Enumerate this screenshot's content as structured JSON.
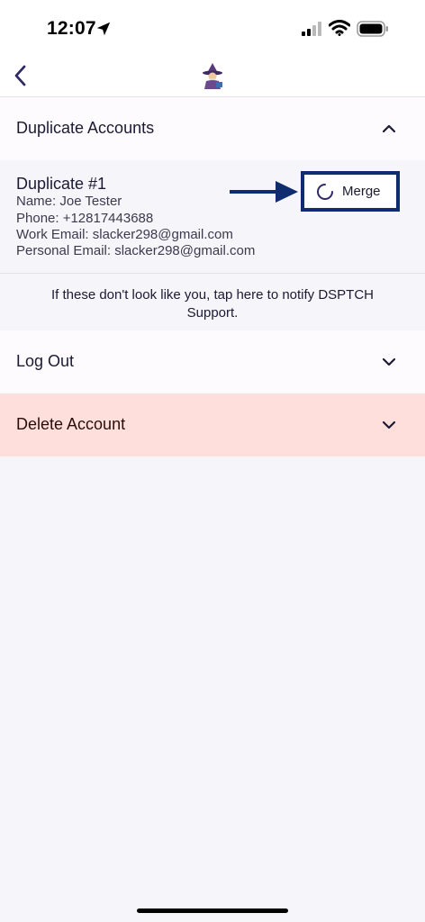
{
  "status_bar": {
    "time": "12:07",
    "icons": [
      "location-arrow-icon",
      "cellular-signal-icon",
      "wifi-icon",
      "battery-icon"
    ]
  },
  "nav": {
    "back_icon": "chevron-left-icon",
    "avatar_icon": "wizard-avatar-icon"
  },
  "sections": {
    "duplicate_accounts": {
      "label": "Duplicate Accounts",
      "expanded": true
    },
    "log_out": {
      "label": "Log Out",
      "expanded": false
    },
    "delete_account": {
      "label": "Delete Account",
      "expanded": false
    }
  },
  "duplicate": {
    "title": "Duplicate #1",
    "name": "Name: Joe Tester",
    "phone": "Phone: +12817443688",
    "work_email": "Work Email: slacker298@gmail.com",
    "personal_email": "Personal Email: slacker298@gmail.com",
    "merge_label": "Merge",
    "merge_loading": true
  },
  "notify_text": "If these don't look like you, tap here to notify DSPTCH Support.",
  "colors": {
    "accent": "#2f2a66",
    "annotation": "#0f2d6e",
    "danger_bg": "#ffdfdc",
    "page_bg": "#f6f5fa"
  }
}
